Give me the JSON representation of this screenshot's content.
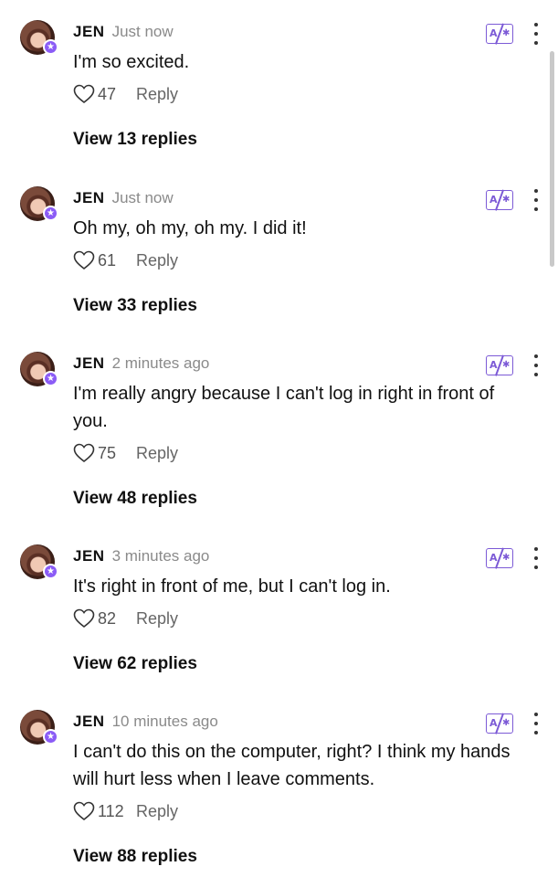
{
  "comments": [
    {
      "author": "JEN",
      "time": "Just now",
      "text": "I'm so excited.",
      "likes": "47",
      "reply_label": "Reply",
      "view_replies": "View 13 replies"
    },
    {
      "author": "JEN",
      "time": "Just now",
      "text": "Oh my, oh my, oh my. I did it!",
      "likes": "61",
      "reply_label": "Reply",
      "view_replies": "View 33 replies"
    },
    {
      "author": "JEN",
      "time": "2 minutes ago",
      "text": "I'm really angry because I can't log in right in front of you.",
      "likes": "75",
      "reply_label": "Reply",
      "view_replies": "View 48 replies"
    },
    {
      "author": "JEN",
      "time": "3 minutes ago",
      "text": "It's right in front of me, but I can't log in.",
      "likes": "82",
      "reply_label": "Reply",
      "view_replies": "View 62 replies"
    },
    {
      "author": "JEN",
      "time": "10 minutes ago",
      "text": "I can't do this on the computer, right? I think my hands will hurt less when I leave comments.",
      "likes": "112",
      "reply_label": "Reply",
      "view_replies": "View 88 replies"
    }
  ],
  "icons": {
    "translate": "translate-icon",
    "more": "more-options-icon",
    "like": "heart-icon",
    "badge": "star-badge-icon"
  },
  "colors": {
    "accent": "#8b5cf6",
    "muted": "#8a8a8a"
  }
}
